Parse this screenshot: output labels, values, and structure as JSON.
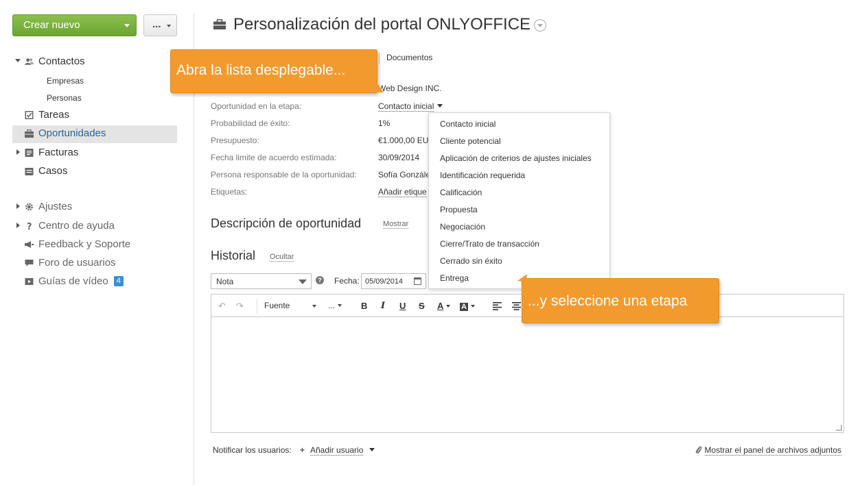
{
  "sidebar": {
    "create_button": "Crear nuevo",
    "more_button": "...",
    "nav": {
      "contactos": "Contactos",
      "empresas": "Empresas",
      "personas": "Personas",
      "tareas": "Tareas",
      "oportunidades": "Oportunidades",
      "facturas": "Facturas",
      "casos": "Casos",
      "ajustes": "Ajustes",
      "centro_ayuda": "Centro de ayuda",
      "feedback": "Feedback y Soporte",
      "foro": "Foro de usuarios",
      "guias": "Guías de vídeo",
      "guias_badge": "4"
    }
  },
  "header": {
    "title": "Personalización del portal ONLYOFFICE",
    "documents_tab": "Documentos"
  },
  "details": {
    "company": "Web Design INC.",
    "stage_label": "Oportunidad en la etapa:",
    "stage_value": "Contacto inicial",
    "probability_label": "Probabilidad de éxito:",
    "probability_value": "1%",
    "budget_label": "Presupuesto:",
    "budget_value": "€1.000,00 EU",
    "close_date_label": "Fecha limite de acuerdo estimada:",
    "close_date_value": "30/09/2014",
    "responsible_label": "Persona responsable de la oportunidad:",
    "responsible_value": "Sofía Gonzále",
    "tags_label": "Etiquetas:",
    "tags_value": "Añadir etique"
  },
  "stage_dropdown": {
    "options": [
      "Contacto inicial",
      "Cliente potencial",
      "Aplicación de criterios de ajustes iniciales",
      "Identificación requerida",
      "Calificación",
      "Propuesta",
      "Negociación",
      "Cierre/Trato de transacción",
      "Cerrado sin éxito",
      "Entrega"
    ]
  },
  "description": {
    "title": "Descripción de oportunidad",
    "toggle": "Mostrar"
  },
  "history": {
    "title": "Historial",
    "toggle": "Ocultar",
    "type_select": "Nota",
    "date_label": "Fecha:",
    "date_value": "05/09/2014",
    "toolbar": {
      "font": "Fuente",
      "size": "...",
      "bold": "B",
      "italic": "I",
      "underline": "U",
      "strike": "S",
      "color": "A",
      "bgcolor": "A"
    },
    "notify_label": "Notificar los usuarios:",
    "add_user": "Añadir usuario",
    "attach_panel": "Mostrar el panel de archivos adjuntos"
  },
  "callouts": {
    "first": "Abra la lista desplegable...",
    "second": "...y seleccione una etapa"
  },
  "colors": {
    "accent_green": "#6ba531",
    "callout_orange": "#f39a2e",
    "active_link": "#2a6496"
  }
}
